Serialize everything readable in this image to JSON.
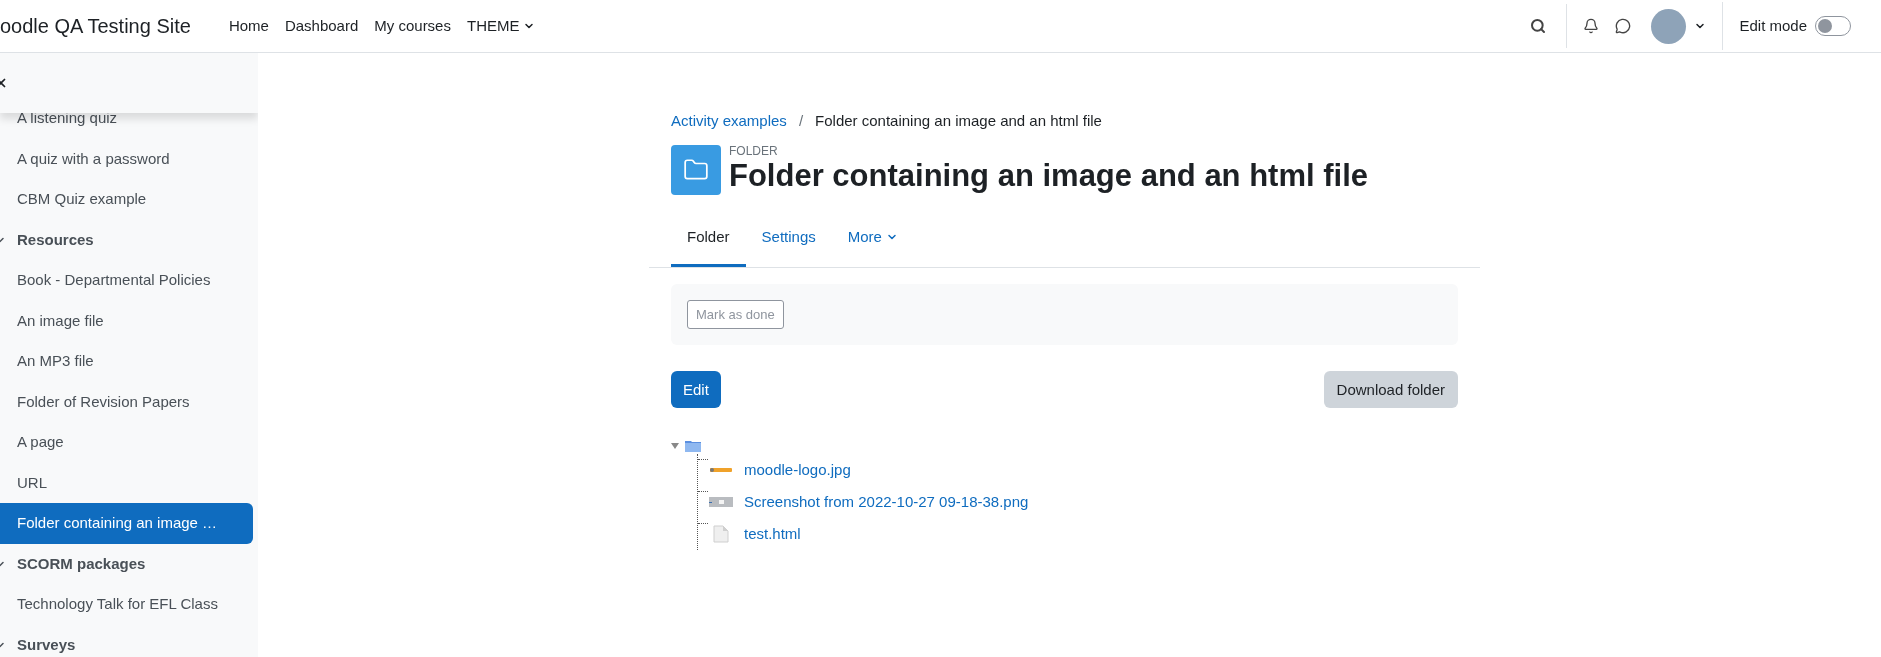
{
  "navbar": {
    "site_name": "oodle QA Testing Site",
    "links": [
      {
        "label": "Home",
        "kind": "link"
      },
      {
        "label": "Dashboard",
        "kind": "link"
      },
      {
        "label": "My courses",
        "kind": "link"
      },
      {
        "label": "THEME",
        "kind": "dropdown"
      }
    ],
    "edit_mode": {
      "label": "Edit mode",
      "on": false
    }
  },
  "sidebar": {
    "items": [
      {
        "label": "A listening quiz",
        "kind": "item",
        "selected": false
      },
      {
        "label": "A quiz with a password",
        "kind": "item",
        "selected": false
      },
      {
        "label": "CBM Quiz example",
        "kind": "item",
        "selected": false
      },
      {
        "label": "Resources",
        "kind": "section",
        "expanded": true,
        "selected": false
      },
      {
        "label": "Book - Departmental Policies",
        "kind": "item",
        "selected": false
      },
      {
        "label": "An image file",
        "kind": "item",
        "selected": false
      },
      {
        "label": "An MP3 file",
        "kind": "item",
        "selected": false
      },
      {
        "label": "Folder of Revision Papers",
        "kind": "item",
        "selected": false
      },
      {
        "label": "A page",
        "kind": "item",
        "selected": false
      },
      {
        "label": "URL",
        "kind": "item",
        "selected": false
      },
      {
        "label": "Folder containing an image …",
        "kind": "item",
        "selected": true
      },
      {
        "label": "SCORM packages",
        "kind": "section",
        "expanded": true,
        "selected": false
      },
      {
        "label": "Technology Talk for EFL Class",
        "kind": "item",
        "selected": false
      },
      {
        "label": "Surveys",
        "kind": "section",
        "expanded": true,
        "selected": false
      }
    ]
  },
  "breadcrumb": [
    {
      "label": "Activity examples",
      "kind": "link"
    },
    {
      "label": "/",
      "kind": "separator"
    },
    {
      "label": "Folder containing an image and an html file",
      "kind": "current"
    }
  ],
  "activity": {
    "type_label": "FOLDER",
    "title": "Folder containing an image and an html file"
  },
  "tabs": [
    {
      "label": "Folder",
      "selected": true,
      "kind": "tab"
    },
    {
      "label": "Settings",
      "selected": false,
      "kind": "tab"
    },
    {
      "label": "More",
      "selected": false,
      "kind": "dropdown"
    }
  ],
  "completion": {
    "label": "Mark as done"
  },
  "buttons": {
    "edit": "Edit",
    "download": "Download folder"
  },
  "tree": {
    "expanded": true,
    "files": [
      {
        "name": "moodle-logo.jpg"
      },
      {
        "name": "Screenshot from 2022-10-27 09-18-38.png",
        "kind": "screenshot"
      },
      {
        "name": "test.html",
        "kind": "html"
      }
    ]
  }
}
